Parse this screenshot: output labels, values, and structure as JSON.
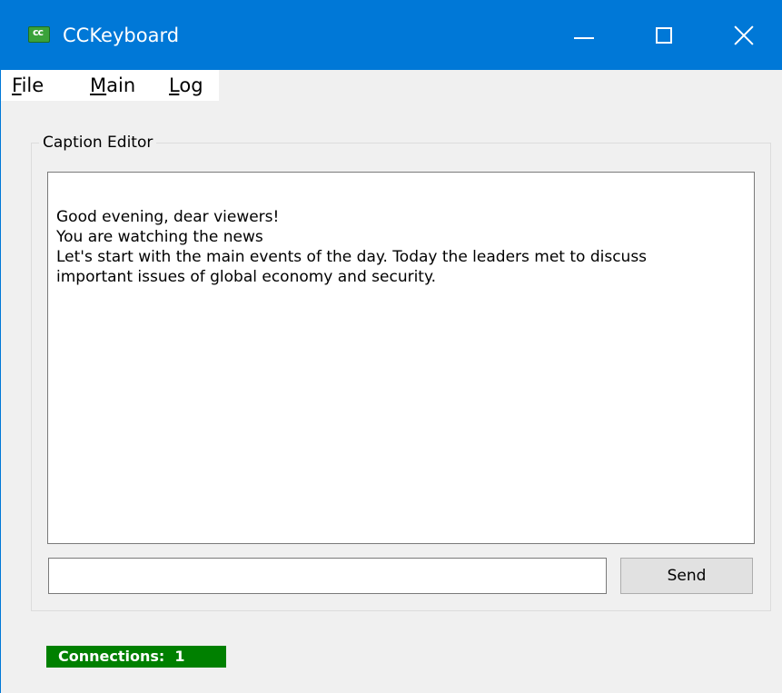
{
  "window": {
    "title": "CCKeyboard",
    "icon": "cc-app-icon",
    "controls": [
      "minimize-icon",
      "maximize-icon",
      "close-icon"
    ]
  },
  "menu": {
    "items": [
      {
        "label": "File"
      },
      {
        "label": "Main"
      },
      {
        "label": "Log"
      }
    ]
  },
  "caption_editor": {
    "group_label": "Caption Editor",
    "lines": [
      "Good evening, dear viewers!",
      "You are watching the news",
      "Let's start with the main events of the day. Today the leaders met to discuss",
      "important issues of global economy and security."
    ],
    "input_value": "",
    "send_label": "Send"
  },
  "status": {
    "connections_label": "Connections:  1",
    "color": "#008000"
  },
  "colors": {
    "titlebar": "#0078d7",
    "window_bg": "#f0f0f0"
  }
}
